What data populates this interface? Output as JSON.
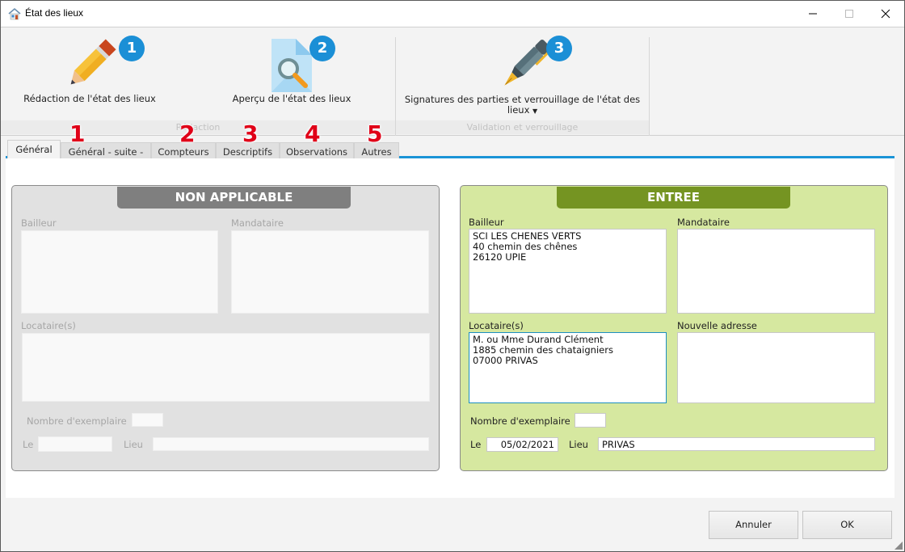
{
  "window": {
    "title": "État des lieux",
    "icon": "house-icon",
    "controls": {
      "minimize": "minimize-icon",
      "maximize": "maximize-icon",
      "close": "close-icon"
    }
  },
  "ribbon": {
    "groups": [
      {
        "label": "Rédaction",
        "buttons": [
          {
            "label": "Rédaction de l'état des lieux",
            "icon": "pencil-icon",
            "badge": "1"
          },
          {
            "label": "Aperçu de l'état des lieux",
            "icon": "document-preview-icon",
            "badge": "2"
          }
        ]
      },
      {
        "label": "Validation et verrouillage",
        "buttons": [
          {
            "label": "Signatures des parties et verrouillage de l'état des",
            "label_line2": "lieux",
            "icon": "fountain-pen-icon",
            "badge": "3",
            "has_dropdown": true
          }
        ]
      }
    ]
  },
  "tabs": {
    "items": [
      {
        "label": "Général",
        "active": true
      },
      {
        "label": "Général - suite -",
        "marker": "1"
      },
      {
        "label": "Compteurs",
        "marker": "2"
      },
      {
        "label": "Descriptifs",
        "marker": "3"
      },
      {
        "label": "Observations",
        "marker": "4"
      },
      {
        "label": "Autres",
        "marker": "5"
      }
    ]
  },
  "panels": {
    "non_applicable": {
      "title": "NON APPLICABLE",
      "bailleur_label": "Bailleur",
      "bailleur_value": "",
      "mandataire_label": "Mandataire",
      "mandataire_value": "",
      "locataires_label": "Locataire(s)",
      "locataires_value": "",
      "nombre_label": "Nombre d'exemplaire",
      "nombre_value": "",
      "le_label": "Le",
      "le_value": "",
      "lieu_label": "Lieu",
      "lieu_value": ""
    },
    "entree": {
      "title": "ENTREE",
      "bailleur_label": "Bailleur",
      "bailleur_value": "SCI LES CHENES VERTS\n40 chemin des chênes\n26120 UPIE",
      "mandataire_label": "Mandataire",
      "mandataire_value": "",
      "locataires_label": "Locataire(s)",
      "locataires_value": "M. ou Mme Durand Clément\n1885 chemin des chataigniers\n07000 PRIVAS",
      "nouvelle_adresse_label": "Nouvelle adresse",
      "nouvelle_adresse_value": "",
      "nombre_label": "Nombre d'exemplaire",
      "nombre_value": "",
      "le_label": "Le",
      "le_value": "05/02/2021",
      "lieu_label": "Lieu",
      "lieu_value": "PRIVAS"
    }
  },
  "footer": {
    "cancel_label": "Annuler",
    "ok_label": "OK"
  },
  "colors": {
    "accent": "#1a94d6",
    "badge": "#1b8fd6",
    "marker": "#e00018",
    "entree_bg": "#d6e8a0",
    "entree_header": "#759422",
    "na_bg": "#e1e1e1",
    "na_header": "#7f7f7f"
  }
}
